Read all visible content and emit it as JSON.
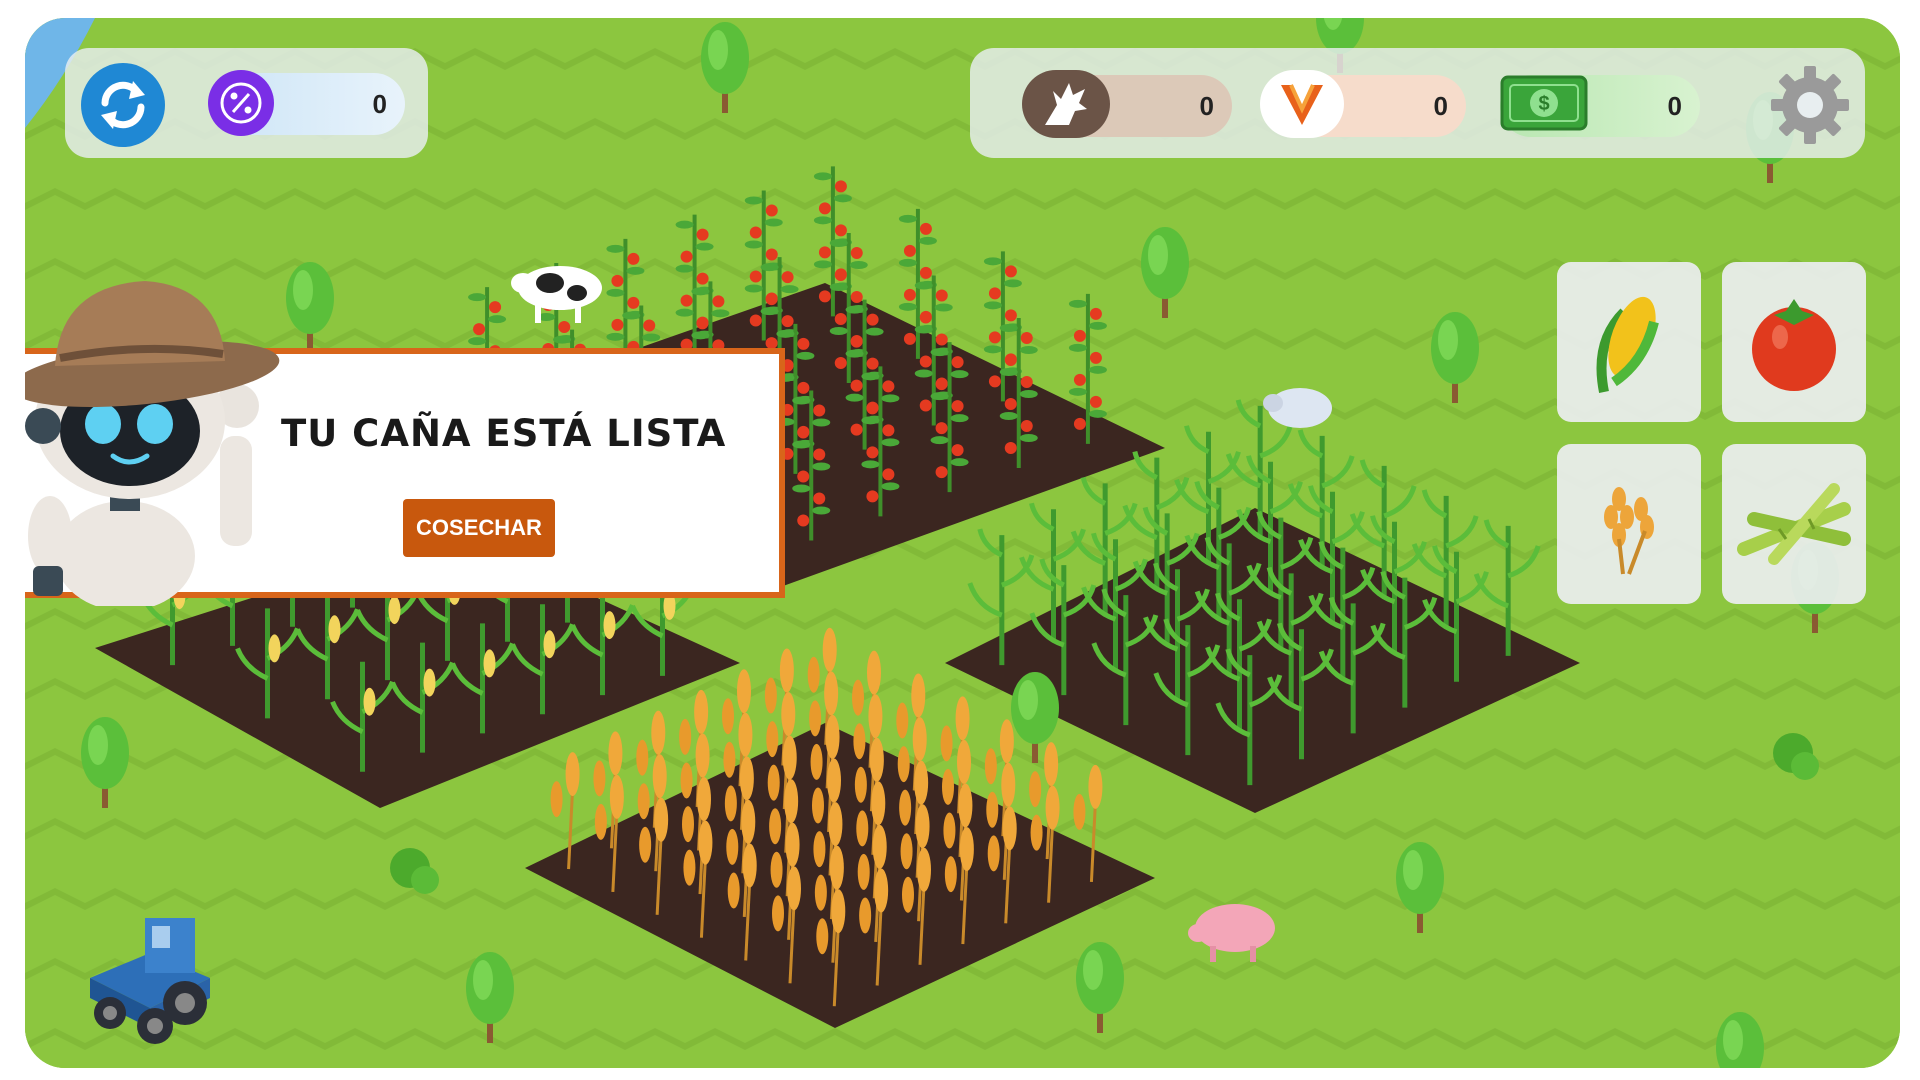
{
  "hud": {
    "refresh_icon": "refresh-icon",
    "percent_icon": "percent-icon",
    "percent_value": "0",
    "wolf_icon": "howling-wolf-icon",
    "wolf_value": "0",
    "v_logo_icon": "v-logo-icon",
    "v_value": "0",
    "money_icon": "money-bill-icon",
    "money_value": "0",
    "settings_icon": "gear-icon"
  },
  "notice": {
    "message": "TU CAÑA ESTÁ LISTA",
    "button_label": "COSECHAR"
  },
  "crop_menu": [
    {
      "name": "corn",
      "icon": "corn-icon"
    },
    {
      "name": "tomato",
      "icon": "tomato-icon"
    },
    {
      "name": "wheat",
      "icon": "wheat-icon"
    },
    {
      "name": "sugarcane",
      "icon": "sugarcane-icon"
    }
  ],
  "colors": {
    "grass": "#8cc63f",
    "soil": "#3b2620",
    "accent_orange": "#c8580d",
    "notice_border": "#d8651a",
    "refresh_blue": "#1f88d4",
    "percent_purple": "#7a2ee6"
  }
}
